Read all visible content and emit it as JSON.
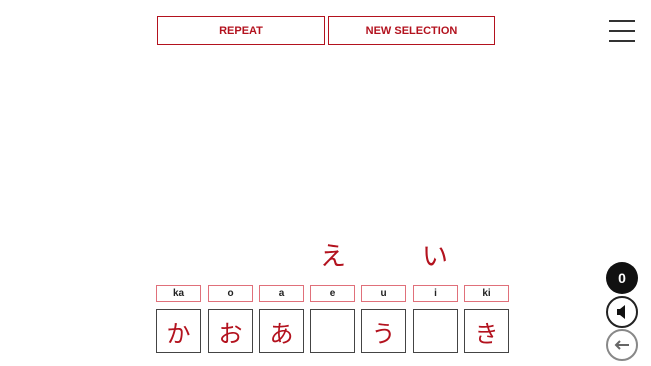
{
  "toolbar": {
    "repeat_label": "REPEAT",
    "new_selection_label": "NEW SELECTION"
  },
  "icons": {
    "menu": "hamburger-menu-icon",
    "sound": "speaker-icon",
    "back": "back-arrow-icon"
  },
  "floating": {
    "e": "え",
    "i": "い"
  },
  "slots": [
    {
      "romaji": "ka",
      "kana": "か"
    },
    {
      "romaji": "o",
      "kana": "お"
    },
    {
      "romaji": "a",
      "kana": "あ"
    },
    {
      "romaji": "e",
      "kana": ""
    },
    {
      "romaji": "u",
      "kana": "う"
    },
    {
      "romaji": "i",
      "kana": ""
    },
    {
      "romaji": "ki",
      "kana": "き"
    }
  ],
  "score": "0",
  "colors": {
    "accent": "#b3121e",
    "border": "#444444",
    "badge": "#111111"
  }
}
